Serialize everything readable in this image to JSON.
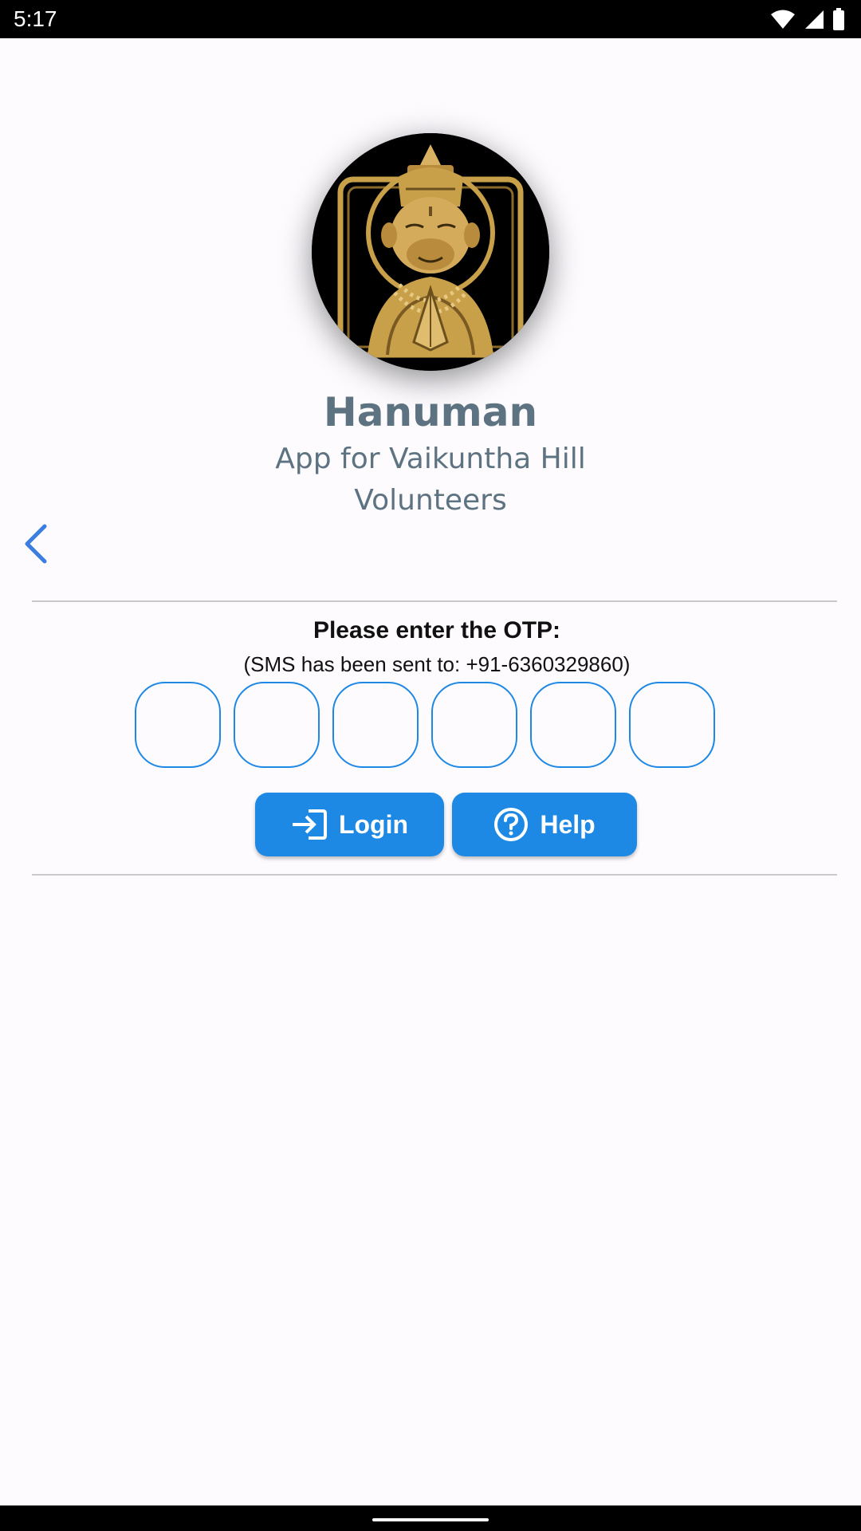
{
  "status_bar": {
    "time": "5:17"
  },
  "app": {
    "title": "Hanuman",
    "subtitle": "App for Vaikuntha Hill Volunteers"
  },
  "otp": {
    "title": "Please enter the OTP:",
    "sms_info": "(SMS has been sent to: +91-6360329860)",
    "digits": [
      "",
      "",
      "",
      "",
      "",
      ""
    ]
  },
  "buttons": {
    "login_label": "Login",
    "help_label": "Help"
  },
  "colors": {
    "accent": "#1e88e5",
    "title_text": "#5d7381",
    "back_arrow": "#3b7ee0",
    "logo_gold": "#c9a04a"
  }
}
